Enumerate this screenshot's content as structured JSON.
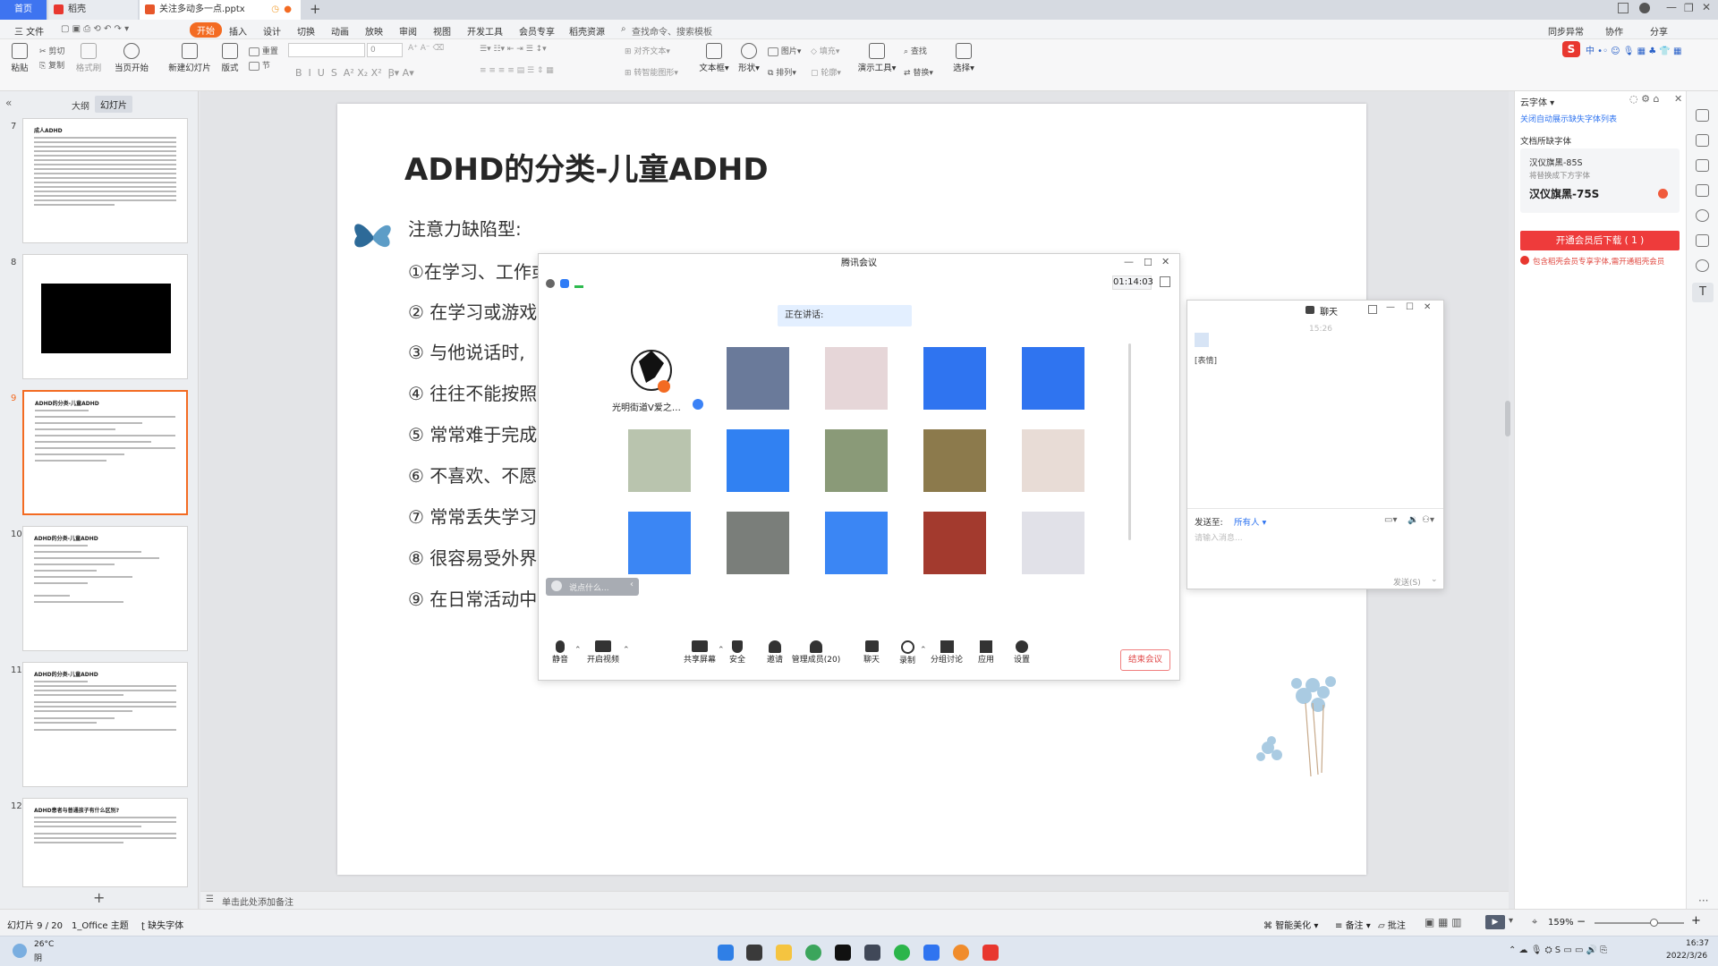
{
  "titlebar": {
    "tab_home": "首页",
    "tab_daoke": "稻壳",
    "tab_file": "关注多动多一点.pptx"
  },
  "menu": {
    "file": "三 文件",
    "items": [
      "开始",
      "插入",
      "设计",
      "切换",
      "动画",
      "放映",
      "审阅",
      "视图",
      "开发工具",
      "会员专享",
      "稻壳资源"
    ],
    "search": "查找命令、搜索模板",
    "right": [
      "同步异常",
      "协作",
      "分享"
    ]
  },
  "ribbon": {
    "paste": "粘贴",
    "cut": "剪切",
    "copy": "复制",
    "format_painter": "格式刷",
    "from_current": "当页开始",
    "new_slide": "新建幻灯片",
    "layout": "版式",
    "reset": "重置",
    "section": "节",
    "font_size": "0",
    "align": "对齐文本",
    "convert_smartart": "转智能图形",
    "textbox": "文本框",
    "shape": "形状",
    "picture": "图片",
    "fill": "填充",
    "arrange": "排列",
    "outline": "轮廓",
    "present_tools": "演示工具",
    "find": "查找",
    "replace": "替换",
    "select": "选择"
  },
  "leftpanel": {
    "tab_outline": "大纲",
    "tab_slides": "幻灯片",
    "thumbs": [
      {
        "num": "7",
        "title": "成人ADHD"
      },
      {
        "num": "8",
        "title": ""
      },
      {
        "num": "9",
        "title": "ADHD的分类-儿童ADHD"
      },
      {
        "num": "10",
        "title": "ADHD的分类-儿童ADHD"
      },
      {
        "num": "11",
        "title": "ADHD的分类-儿童ADHD"
      },
      {
        "num": "12",
        "title": "ADHD患者与普通孩子有什么区别?"
      }
    ]
  },
  "slide": {
    "title": "ADHD的分类-儿童ADHD",
    "subtitle": "注意力缺陷型:",
    "lines": [
      "①在学习、工作或",
      "② 在学习或游戏",
      "③ 与他说话时,",
      "④ 往往不能按照",
      "⑤ 常常难于完成有",
      "⑥ 不喜欢、不愿意",
      "⑦ 常常丢失学习、",
      "⑧ 很容易受外界",
      "⑨ 在日常活动中"
    ]
  },
  "meeting": {
    "title": "腾讯会议",
    "timer": "01:14:03",
    "speaking": "正在讲话:",
    "host_name": "光明街道V爱之…",
    "input_placeholder": "说点什么...",
    "toolbar": [
      {
        "label": "静音",
        "icon": "microphone-icon"
      },
      {
        "label": "开启视频",
        "icon": "camera-off-icon"
      },
      {
        "label": "共享屏幕",
        "icon": "share-screen-icon"
      },
      {
        "label": "安全",
        "icon": "shield-icon"
      },
      {
        "label": "邀请",
        "icon": "invite-icon"
      },
      {
        "label": "管理成员(20)",
        "icon": "members-icon"
      },
      {
        "label": "聊天",
        "icon": "chat-icon"
      },
      {
        "label": "录制",
        "icon": "record-icon"
      },
      {
        "label": "分组讨论",
        "icon": "breakout-icon"
      },
      {
        "label": "应用",
        "icon": "apps-icon"
      },
      {
        "label": "设置",
        "icon": "settings-icon"
      }
    ],
    "end_button": "结束会议"
  },
  "chat": {
    "title": "聊天",
    "time": "15:26",
    "message": "[表情]",
    "send_to_label": "发送至:",
    "send_to_value": "所有人",
    "input_placeholder": "请输入消息...",
    "send_button": "发送(S)"
  },
  "rightpane": {
    "header": "云字体",
    "auto_close": "关闭自动展示缺失字体列表",
    "missing_title": "文档所缺字体",
    "missing_font": "汉仪旗黑-85S",
    "replace_hint": "将替换成下方字体",
    "replace_font": "汉仪旗黑-75S",
    "vip_button": "开通会员后下载 ( 1 )",
    "vip_note": "包含稻壳会员专享字体,需开通稻壳会员"
  },
  "notes": {
    "placeholder": "单击此处添加备注"
  },
  "statusbar": {
    "slide_index": "幻灯片 9 / 20",
    "theme": "1_Office 主题",
    "missing_font": "缺失字体",
    "beautify": "智能美化",
    "notes": "备注",
    "comments": "批注",
    "zoom": "159%"
  },
  "taskbar": {
    "temperature": "26°C",
    "weather": "阴",
    "time": "16:37",
    "date": "2022/3/26"
  },
  "colors": {
    "accent_orange": "#f36b22",
    "wps_red": "#e8372f",
    "meeting_blue": "#3b82f6",
    "vip_red": "#ee3b3b"
  }
}
